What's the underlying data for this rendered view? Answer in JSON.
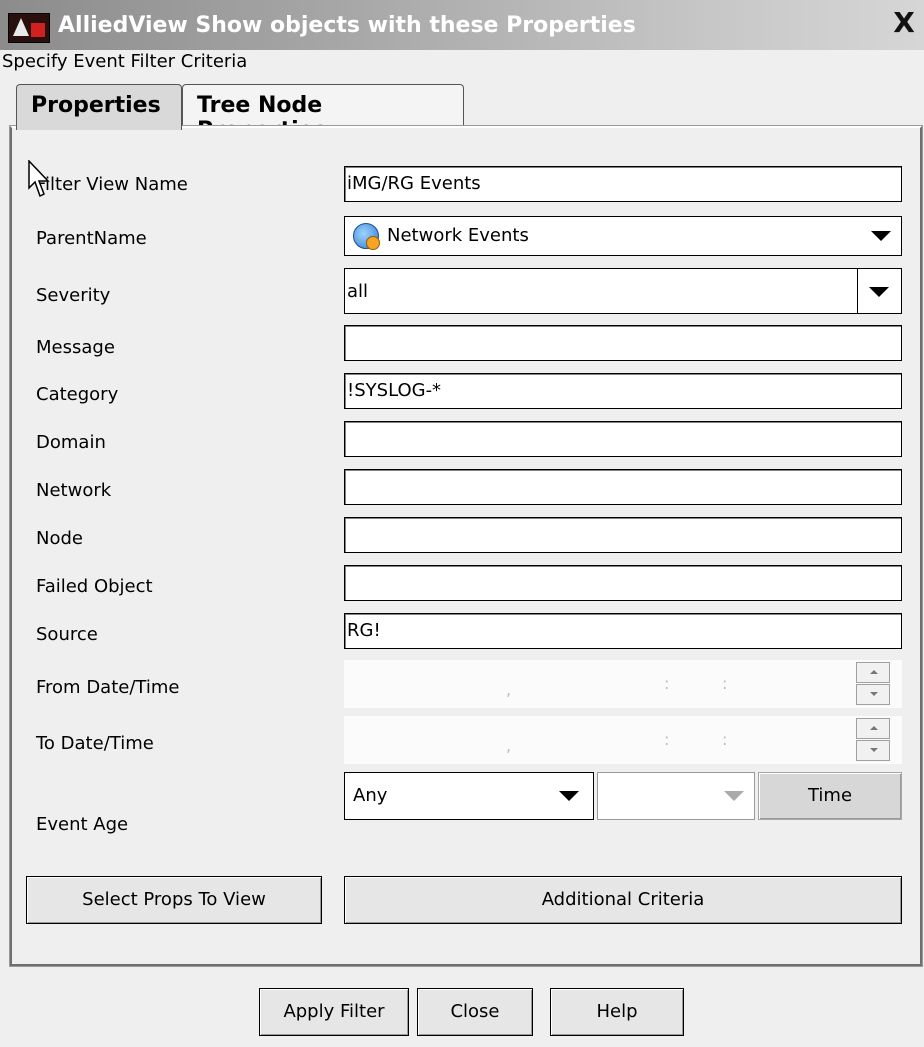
{
  "window": {
    "title": "AlliedView Show objects with these Properties",
    "close": "X"
  },
  "subtitle": "Specify Event Filter Criteria",
  "tabs": [
    {
      "label": "Properties",
      "active": true
    },
    {
      "label": "Tree Node Properties",
      "active": false
    }
  ],
  "fields": {
    "filter_view_name": {
      "label": "Filter View Name",
      "value": "iMG/RG Events"
    },
    "parent_name": {
      "label": "ParentName",
      "value": "Network Events"
    },
    "severity": {
      "label": "Severity",
      "value": "all"
    },
    "message": {
      "label": "Message",
      "value": ""
    },
    "category": {
      "label": "Category",
      "value": "!SYSLOG-*"
    },
    "domain": {
      "label": "Domain",
      "value": ""
    },
    "network": {
      "label": "Network",
      "value": ""
    },
    "node": {
      "label": "Node",
      "value": ""
    },
    "failed_object": {
      "label": "Failed Object",
      "value": ""
    },
    "source": {
      "label": "Source",
      "value": "RG!"
    },
    "from_datetime": {
      "label": "From Date/Time",
      "sep1": ",",
      "sep2": ":",
      "sep3": ":"
    },
    "to_datetime": {
      "label": "To Date/Time",
      "sep1": ",",
      "sep2": ":",
      "sep3": ":"
    },
    "event_age": {
      "label": "Event Age",
      "value": "Any",
      "unit_value": "",
      "time_button": "Time"
    }
  },
  "panel_buttons": {
    "select_props": "Select Props To View",
    "additional_criteria": "Additional Criteria"
  },
  "footer_buttons": {
    "apply": "Apply Filter",
    "close": "Close",
    "help": "Help"
  },
  "icons": {
    "app": "alliedview-logo-icon",
    "parent_name_value": "network-events-icon",
    "cursor": "mouse-pointer-icon"
  }
}
